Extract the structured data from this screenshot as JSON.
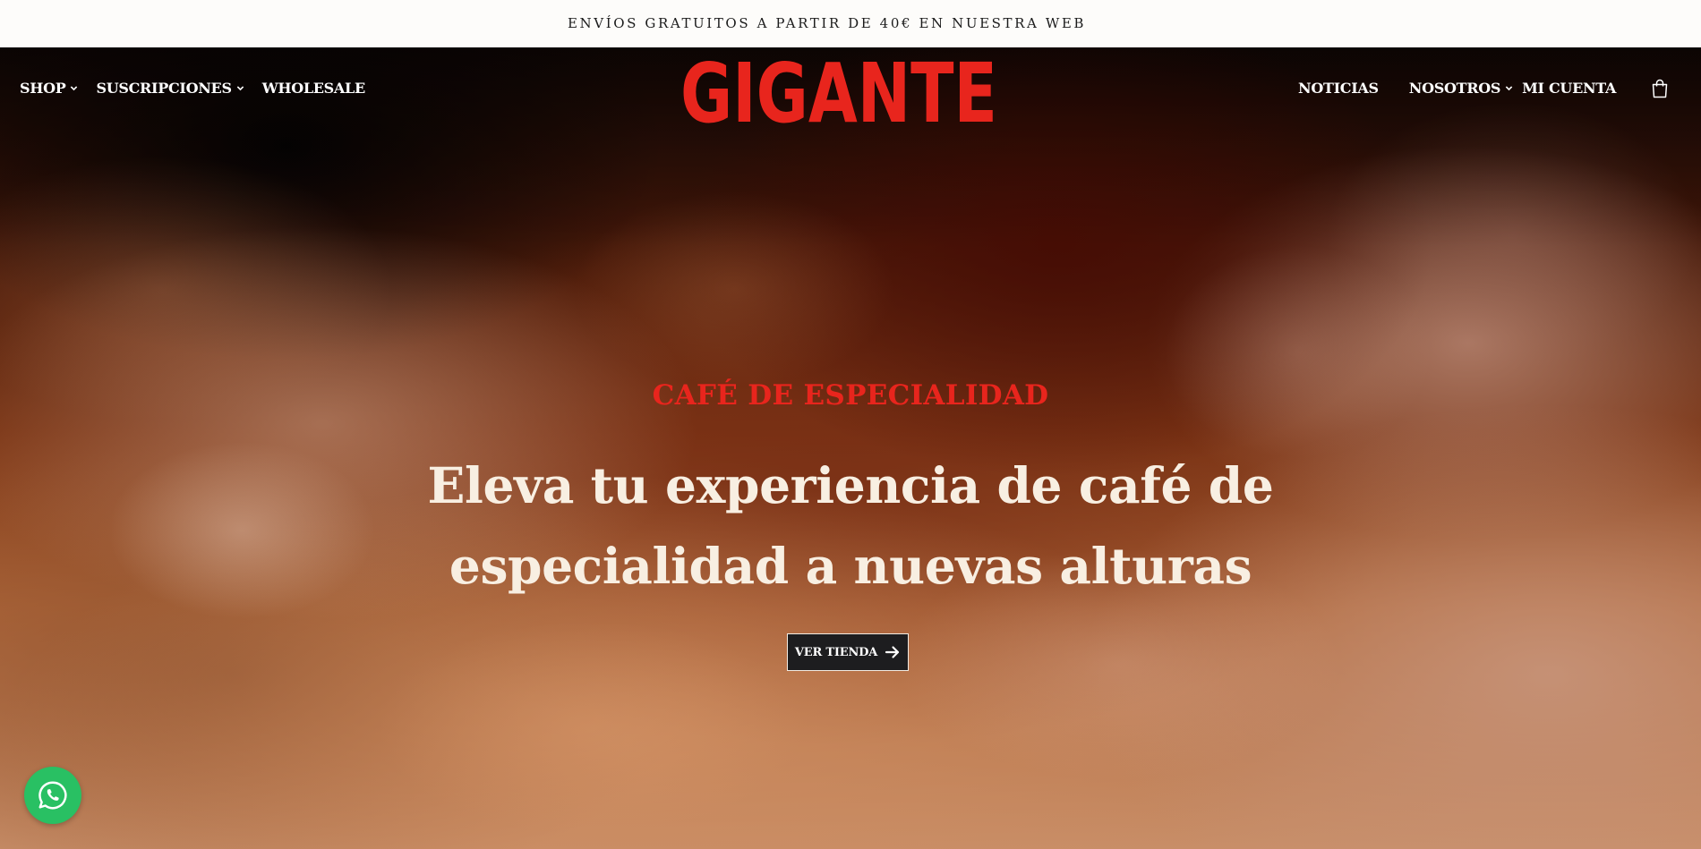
{
  "announcement": {
    "text": "ENVÍOS GRATUITOS A PARTIR DE 40€ EN NUESTRA WEB"
  },
  "brand": {
    "logo_text": "GIGANTE",
    "logo_color": "#e8251d"
  },
  "nav_left": [
    {
      "label": "SHOP",
      "has_dropdown": true
    },
    {
      "label": "SUSCRIPCIONES",
      "has_dropdown": true
    },
    {
      "label": "WHOLESALE",
      "has_dropdown": false
    }
  ],
  "nav_right": [
    {
      "label": "NOTICIAS",
      "has_dropdown": false
    },
    {
      "label": "NOSOTROS",
      "has_dropdown": true
    },
    {
      "label": "MI CUENTA",
      "has_dropdown": false
    }
  ],
  "cart": {
    "icon": "shopping-bag-icon"
  },
  "hero": {
    "eyebrow": "CAFÉ DE ESPECIALIDAD",
    "headline_line1": "Eleva tu experiencia de café de",
    "headline_line2": "especialidad a nuevas alturas",
    "cta_label": "VER TIENDA",
    "cta_icon": "arrow-right-icon"
  },
  "whatsapp": {
    "icon": "whatsapp-icon",
    "color": "#29c063"
  },
  "colors": {
    "accent_red": "#e8251d",
    "headline_cream": "#f8efe2",
    "button_dark": "#1d1d1f"
  }
}
